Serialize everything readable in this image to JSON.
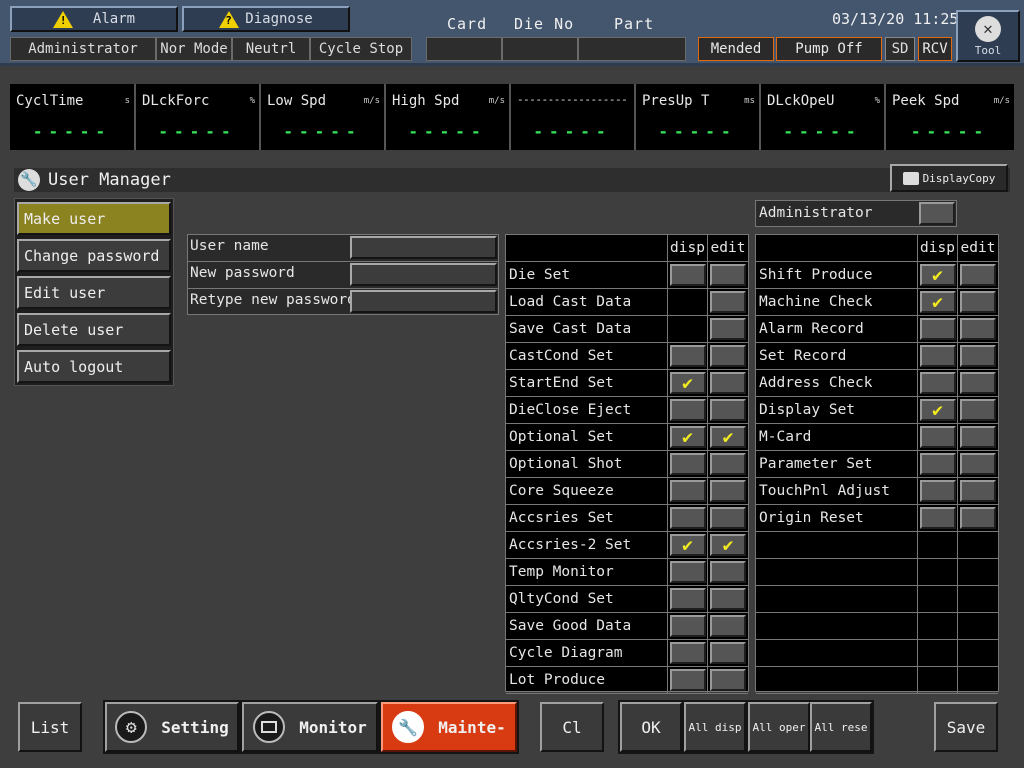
{
  "header": {
    "alarm_label": "Alarm",
    "diagnose_label": "Diagnose",
    "status": [
      "Administrator",
      "Nor Mode",
      "Neutrl",
      "Cycle Stop"
    ],
    "card_label": "Card",
    "die_no_label": "Die No",
    "part_label": "Part",
    "datetime": "03/13/20 11:25",
    "mended_label": "Mended",
    "pump_label": "Pump Off",
    "sd_label": "SD",
    "rcv_label": "RCV",
    "tool_label": "Tool"
  },
  "gauges": [
    {
      "name": "CyclTime",
      "unit": "s",
      "value": "-----"
    },
    {
      "name": "DLckForc",
      "unit": "%",
      "value": "-----"
    },
    {
      "name": "Low Spd",
      "unit": "m/s",
      "value": "-----"
    },
    {
      "name": "High Spd",
      "unit": "m/s",
      "value": "-----"
    },
    {
      "name": "------------------",
      "unit": "",
      "value": "-----"
    },
    {
      "name": "PresUp T",
      "unit": "ms",
      "value": "-----"
    },
    {
      "name": "DLckOpeU",
      "unit": "%",
      "value": "-----"
    },
    {
      "name": "Peek Spd",
      "unit": "m/s",
      "value": "-----"
    }
  ],
  "page": {
    "title": "User Manager",
    "display_copy_label": "DisplayCopy"
  },
  "sidebar": {
    "items": [
      {
        "label": "Make user",
        "active": true
      },
      {
        "label": "Change password",
        "active": false
      },
      {
        "label": "Edit user",
        "active": false
      },
      {
        "label": "Delete user",
        "active": false
      },
      {
        "label": "Auto logout",
        "active": false
      }
    ]
  },
  "form": {
    "fields": [
      {
        "label": "User name",
        "value": ""
      },
      {
        "label": "New password",
        "value": ""
      },
      {
        "label": "Retype new password",
        "value": ""
      }
    ]
  },
  "administrator_label": "Administrator",
  "perm_headers": {
    "disp": "disp",
    "edit": "edit"
  },
  "permissions_left": [
    {
      "name": "Die Set",
      "disp": false,
      "edit": false,
      "has_disp": true
    },
    {
      "name": "Load Cast Data",
      "disp": false,
      "edit": false,
      "has_disp": false
    },
    {
      "name": "Save Cast Data",
      "disp": false,
      "edit": false,
      "has_disp": false
    },
    {
      "name": "CastCond Set",
      "disp": false,
      "edit": false,
      "has_disp": true
    },
    {
      "name": "StartEnd Set",
      "disp": true,
      "edit": false,
      "has_disp": true
    },
    {
      "name": "DieClose Eject",
      "disp": false,
      "edit": false,
      "has_disp": true
    },
    {
      "name": "Optional Set",
      "disp": true,
      "edit": true,
      "has_disp": true
    },
    {
      "name": "Optional Shot",
      "disp": false,
      "edit": false,
      "has_disp": true
    },
    {
      "name": "Core Squeeze",
      "disp": false,
      "edit": false,
      "has_disp": true
    },
    {
      "name": "Accsries Set",
      "disp": false,
      "edit": false,
      "has_disp": true
    },
    {
      "name": "Accsries-2 Set",
      "disp": true,
      "edit": true,
      "has_disp": true
    },
    {
      "name": "Temp Monitor",
      "disp": false,
      "edit": false,
      "has_disp": true
    },
    {
      "name": "QltyCond Set",
      "disp": false,
      "edit": false,
      "has_disp": true
    },
    {
      "name": "Save Good Data",
      "disp": false,
      "edit": false,
      "has_disp": true
    },
    {
      "name": "Cycle Diagram",
      "disp": false,
      "edit": false,
      "has_disp": true
    },
    {
      "name": "Lot Produce",
      "disp": false,
      "edit": false,
      "has_disp": true
    }
  ],
  "permissions_right": [
    {
      "name": "Shift Produce",
      "disp": true,
      "edit": false
    },
    {
      "name": "Machine Check",
      "disp": true,
      "edit": false
    },
    {
      "name": "Alarm Record",
      "disp": false,
      "edit": false
    },
    {
      "name": "Set Record",
      "disp": false,
      "edit": false
    },
    {
      "name": "Address Check",
      "disp": false,
      "edit": false
    },
    {
      "name": "Display Set",
      "disp": true,
      "edit": false
    },
    {
      "name": "M-Card",
      "disp": false,
      "edit": false
    },
    {
      "name": "Parameter Set",
      "disp": false,
      "edit": false
    },
    {
      "name": "TouchPnl Adjust",
      "disp": false,
      "edit": false
    },
    {
      "name": "Origin Reset",
      "disp": false,
      "edit": false
    }
  ],
  "footer": {
    "list_label": "List",
    "setting_label": "Setting",
    "monitor_label": "Monitor",
    "mainte_label": "Mainte-",
    "cl_label": "Cl",
    "ok_label": "OK",
    "all_disp_label": "All disp",
    "all_oper_label": "All oper",
    "all_rese_label": "All rese",
    "save_label": "Save"
  },
  "colors": {
    "active_menu": "#8b8220",
    "mainte_active": "#d83a12",
    "check": "#f2ea20",
    "gauge_value": "#34e35a"
  }
}
